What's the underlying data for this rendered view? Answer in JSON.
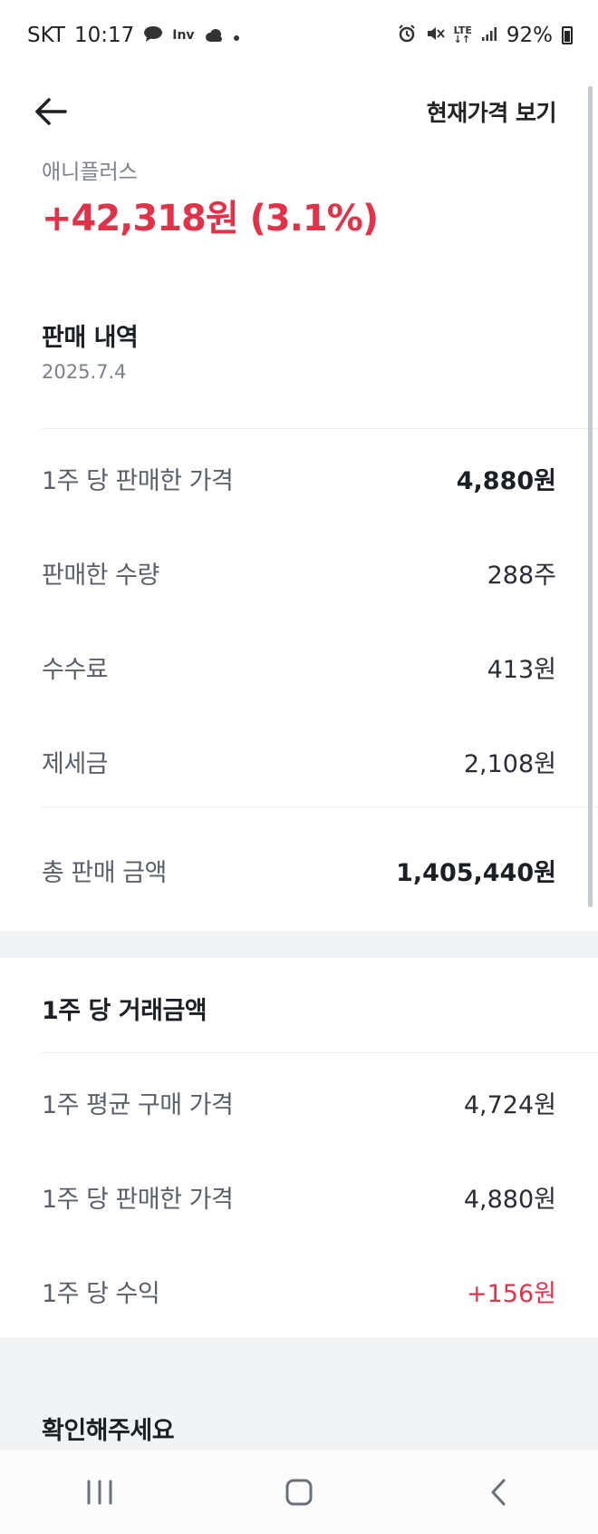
{
  "status_bar": {
    "carrier": "SKT",
    "time": "10:17",
    "battery": "92%",
    "icons": [
      "chat-bubble-icon",
      "inv-app-icon",
      "cloud-icon",
      "dot-icon",
      "alarm-icon",
      "mute-icon",
      "lte-icon",
      "signal-icon",
      "battery-icon"
    ]
  },
  "appbar": {
    "action_label": "현재가격 보기"
  },
  "summary": {
    "stock_name": "애니플러스",
    "profit_text": "+42,318원 (3.1%)"
  },
  "sale_history": {
    "title": "판매 내역",
    "date": "2025.7.4",
    "rows": [
      {
        "label": "1주 당 판매한 가격",
        "value": "4,880원"
      },
      {
        "label": "판매한 수량",
        "value": "288주"
      },
      {
        "label": "수수료",
        "value": "413원"
      },
      {
        "label": "제세금",
        "value": "2,108원"
      }
    ],
    "total": {
      "label": "총 판매 금액",
      "value": "1,405,440원"
    }
  },
  "per_share": {
    "title": "1주 당 거래금액",
    "rows": [
      {
        "label": "1주 평균 구매 가격",
        "value": "4,724원"
      },
      {
        "label": "1주 당 판매한 가격",
        "value": "4,880원"
      },
      {
        "label": "1주 당 수익",
        "value": "+156원"
      }
    ]
  },
  "notice": {
    "title": "확인해주세요"
  },
  "colors": {
    "accent_red": "#e0334a",
    "text_primary": "#1c1f24",
    "text_secondary": "#5b6068",
    "band_gray": "#f2f3f5"
  }
}
